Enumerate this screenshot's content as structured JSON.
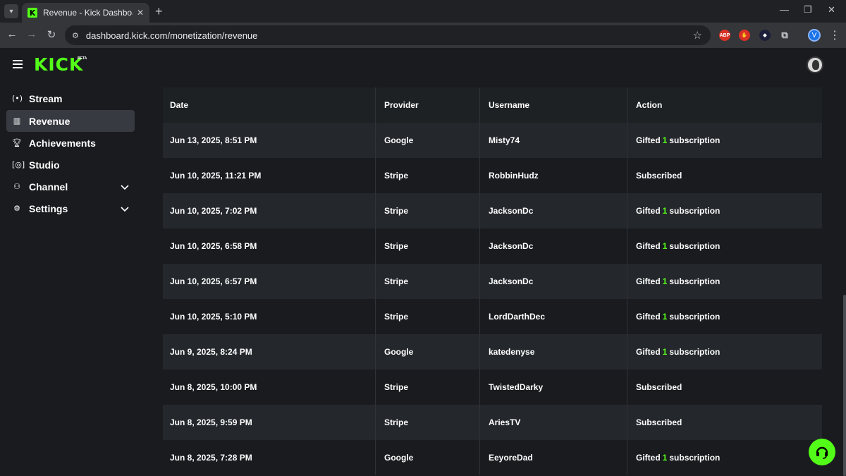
{
  "browser": {
    "tab_title": "Revenue - Kick Dashboard",
    "tab_favicon": "K",
    "url": "dashboard.kick.com/monetization/revenue",
    "profile_initial": "V",
    "extensions": [
      "ABP",
      "adblock-hand-icon",
      "diamond-icon",
      "puzzle-icon"
    ]
  },
  "app": {
    "logo": "KICK",
    "beta": "BETA",
    "brand_color": "#53fc18"
  },
  "sidebar": {
    "items": [
      {
        "label": "Stream",
        "icon": "broadcast-icon"
      },
      {
        "label": "Revenue",
        "icon": "chart-icon"
      },
      {
        "label": "Achievements",
        "icon": "trophy-icon"
      },
      {
        "label": "Studio",
        "icon": "studio-icon"
      },
      {
        "label": "Channel",
        "icon": "people-icon"
      },
      {
        "label": "Settings",
        "icon": "gear-icon"
      }
    ]
  },
  "table": {
    "headers": [
      "Date",
      "Provider",
      "Username",
      "Action"
    ],
    "rows": [
      {
        "date": "Jun 13, 2025, 8:51 PM",
        "provider": "Google",
        "username": "Misty74",
        "action_pre": "Gifted",
        "count": "1",
        "action_post": "subscription"
      },
      {
        "date": "Jun 10, 2025, 11:21 PM",
        "provider": "Stripe",
        "username": "RobbinHudz",
        "action_pre": "Subscribed",
        "count": "",
        "action_post": ""
      },
      {
        "date": "Jun 10, 2025, 7:02 PM",
        "provider": "Stripe",
        "username": "JacksonDc",
        "action_pre": "Gifted",
        "count": "1",
        "action_post": "subscription"
      },
      {
        "date": "Jun 10, 2025, 6:58 PM",
        "provider": "Stripe",
        "username": "JacksonDc",
        "action_pre": "Gifted",
        "count": "1",
        "action_post": "subscription"
      },
      {
        "date": "Jun 10, 2025, 6:57 PM",
        "provider": "Stripe",
        "username": "JacksonDc",
        "action_pre": "Gifted",
        "count": "1",
        "action_post": "subscription"
      },
      {
        "date": "Jun 10, 2025, 5:10 PM",
        "provider": "Stripe",
        "username": "LordDarthDec",
        "action_pre": "Gifted",
        "count": "1",
        "action_post": "subscription"
      },
      {
        "date": "Jun 9, 2025, 8:24 PM",
        "provider": "Google",
        "username": "katedenyse",
        "action_pre": "Gifted",
        "count": "1",
        "action_post": "subscription"
      },
      {
        "date": "Jun 8, 2025, 10:00 PM",
        "provider": "Stripe",
        "username": "TwistedDarky",
        "action_pre": "Subscribed",
        "count": "",
        "action_post": ""
      },
      {
        "date": "Jun 8, 2025, 9:59 PM",
        "provider": "Stripe",
        "username": "AriesTV",
        "action_pre": "Subscribed",
        "count": "",
        "action_post": ""
      },
      {
        "date": "Jun 8, 2025, 7:28 PM",
        "provider": "Google",
        "username": "EeyoreDad",
        "action_pre": "Gifted",
        "count": "1",
        "action_post": "subscription"
      }
    ]
  }
}
